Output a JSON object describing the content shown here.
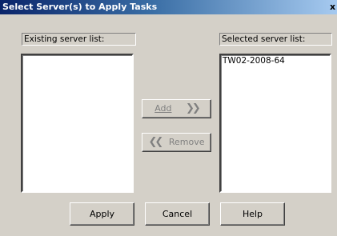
{
  "window": {
    "title": "Select Server(s) to Apply Tasks",
    "close_glyph": "x"
  },
  "existing": {
    "label": "Existing server list:",
    "items": []
  },
  "selected": {
    "label": "Selected server list:",
    "items": [
      "TW02-2008-64"
    ]
  },
  "buttons": {
    "add_label": "Add",
    "add_icon": "double-chevron-right-icon",
    "remove_label": "Remove",
    "remove_icon": "double-chevron-left-icon",
    "apply_label": "Apply",
    "cancel_label": "Cancel",
    "help_label": "Help"
  },
  "colors": {
    "title_start": "#0a246a",
    "title_end": "#a6caf0",
    "face": "#d4d0c8",
    "disabled_text": "#808080"
  }
}
